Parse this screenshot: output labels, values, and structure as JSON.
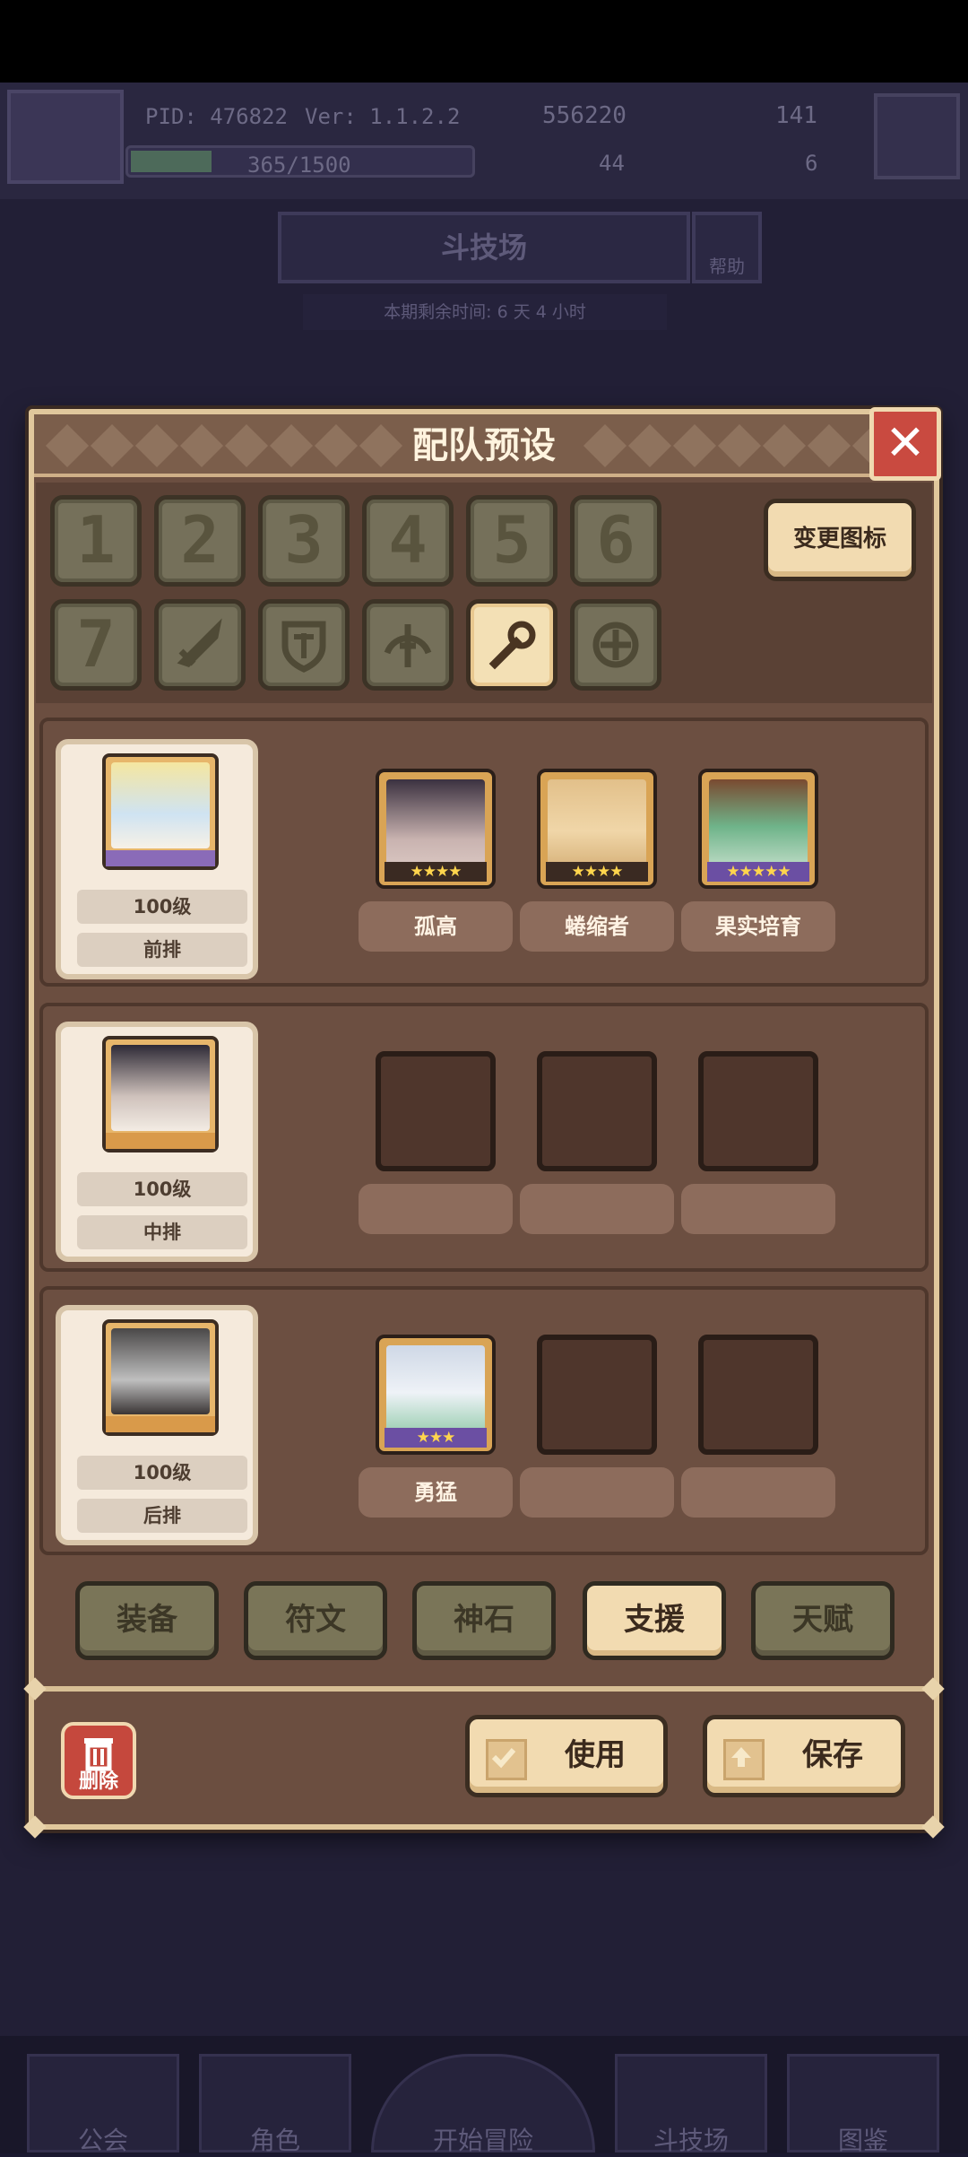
{
  "header": {
    "pid": "PID: 476822",
    "version": "Ver: 1.1.2.2",
    "gold": "556220",
    "gems": "141",
    "exp": "365/1500",
    "stat_a": "44",
    "stat_b": "6"
  },
  "arena": {
    "title": "斗技场",
    "help_label": "帮助",
    "season_remaining": "本期剩余时间: 6 天 4 小时"
  },
  "dialog": {
    "title": "配队预设",
    "change_icon_label": "变更图标",
    "icon_slots": [
      "1",
      "2",
      "3",
      "4",
      "5",
      "6",
      "7"
    ],
    "selected_slot_icon": "wrench-icon"
  },
  "rows": [
    {
      "level": "100级",
      "position": "前排",
      "members": [
        {
          "name": "孤高",
          "stars": "★★★★",
          "filled": true
        },
        {
          "name": "蜷缩者",
          "stars": "★★★★",
          "filled": true
        },
        {
          "name": "果实培育",
          "stars": "★★★★★",
          "filled": true
        }
      ]
    },
    {
      "level": "100级",
      "position": "中排",
      "members": []
    },
    {
      "level": "100级",
      "position": "后排",
      "members": [
        {
          "name": "勇猛",
          "stars": "★★★",
          "filled": true
        }
      ]
    }
  ],
  "tabs": [
    "装备",
    "符文",
    "神石",
    "支援",
    "天赋"
  ],
  "selected_tab": "支援",
  "footer": {
    "delete_label": "删除",
    "use_label": "使用",
    "save_label": "保存"
  },
  "bottom_nav": [
    "公会",
    "角色",
    "开始冒险",
    "斗技场",
    "图鉴"
  ],
  "colors": {
    "panel": "#6b4e40",
    "accent": "#f2dbb1",
    "close_red": "#c94a40"
  }
}
